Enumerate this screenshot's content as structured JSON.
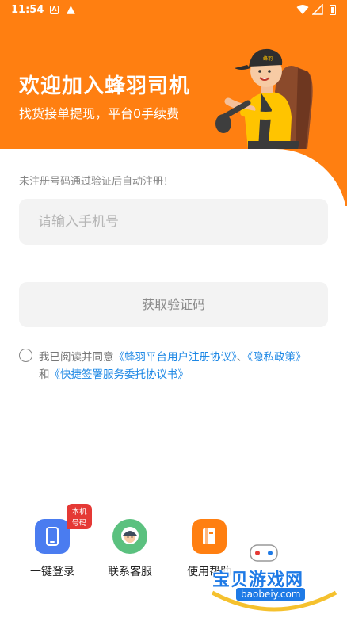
{
  "status_bar": {
    "time": "11:54",
    "notif_letter": "A",
    "warning": "▲"
  },
  "header": {
    "title": "欢迎加入蜂羽司机",
    "subtitle": "找货接单提现，平台0手续费",
    "logo_text": "蜂羽",
    "brand_color": "#FF7F11"
  },
  "form": {
    "hint": "未注册号码通过验证后自动注册！",
    "phone_placeholder": "请输入手机号",
    "get_code_label": "获取验证码"
  },
  "agreement": {
    "prefix": "我已阅读并同意",
    "user_protocol": "《蜂羽平台用户注册协议》",
    "sep": "、",
    "privacy": "《隐私政策》",
    "and": "和",
    "sign_protocol": "《快捷签署服务委托协议书》",
    "link_color": "#1E88E5"
  },
  "shortcuts": [
    {
      "label": "一键登录",
      "badge": "本机号码",
      "icon": "phone-icon",
      "color": "#4A7CF0"
    },
    {
      "label": "联系客服",
      "icon": "service-avatar-icon",
      "color": "#5BC17F"
    },
    {
      "label": "使用帮助",
      "icon": "help-book-icon",
      "color": "#FF7F11"
    }
  ],
  "watermark": {
    "text": "宝贝游戏网",
    "url": "baobeiy.com"
  }
}
